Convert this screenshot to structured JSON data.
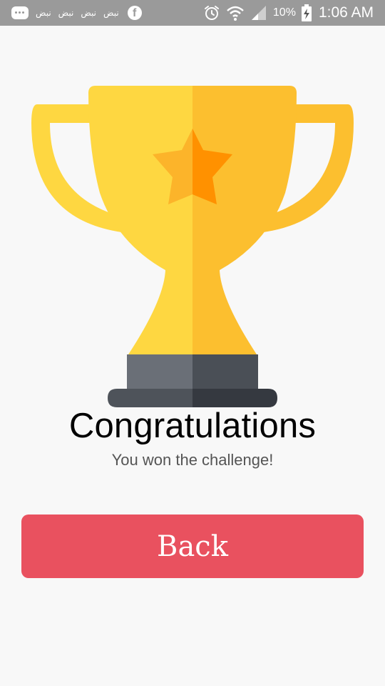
{
  "status_bar": {
    "notifications": [
      "نبض",
      "نبض",
      "نبض",
      "نبض"
    ],
    "battery": "10%",
    "time": "1:06 AM",
    "icons": [
      "chat-icon",
      "facebook-icon",
      "alarm-icon",
      "wifi-icon",
      "signal-icon",
      "battery-charging-icon"
    ]
  },
  "main": {
    "title": "Congratulations",
    "subtitle": "You won the challenge!",
    "back_label": "Back"
  },
  "colors": {
    "status_bar_bg": "#9a9a9a",
    "background": "#f8f8f8",
    "trophy_gold_light": "#fed741",
    "trophy_gold_dark": "#fcbf2f",
    "star_light": "#fcb42a",
    "star_dark": "#ff9100",
    "base_light": "#6a6f77",
    "base_dark": "#4a4f56",
    "base_plate": "#3e4248",
    "button": "#e9515f"
  }
}
